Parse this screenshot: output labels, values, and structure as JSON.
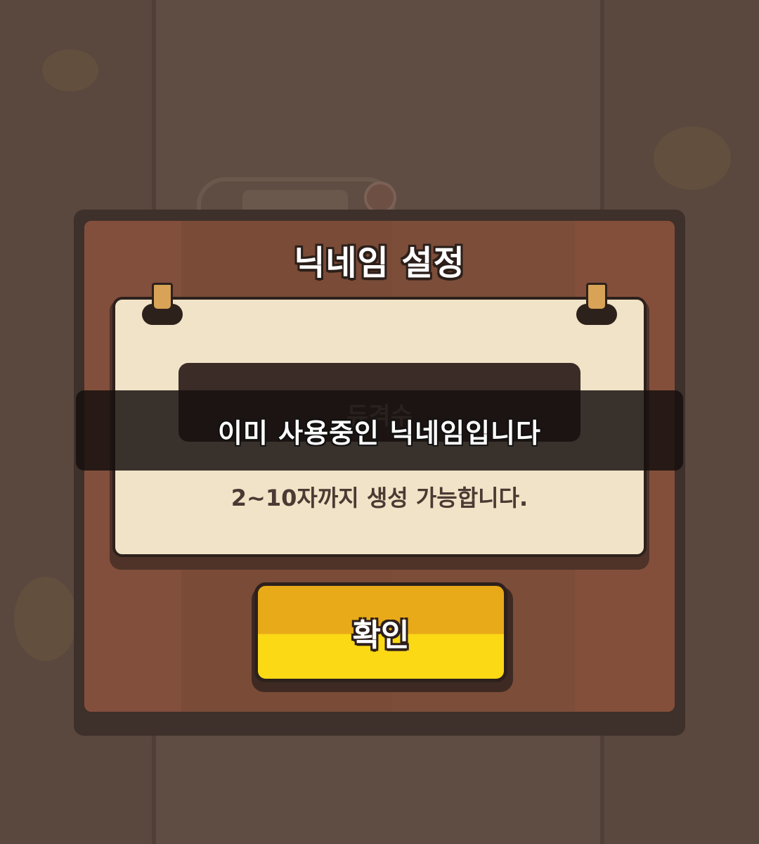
{
  "dialog": {
    "title": "닉네임 설정",
    "nickname_input": {
      "value": "듀격수"
    },
    "hint": "2~10자까지 생성 가능합니다.",
    "confirm_label": "확인"
  },
  "toast": {
    "message": "이미 사용중인 닉네임입니다"
  },
  "colors": {
    "panel_wood": "#7e4f3a",
    "paper": "#f1e3c7",
    "button_top": "#e9aa19",
    "button_bottom": "#fbd915",
    "background": "#5f4c42"
  },
  "icons": [
    "pin-icon"
  ]
}
